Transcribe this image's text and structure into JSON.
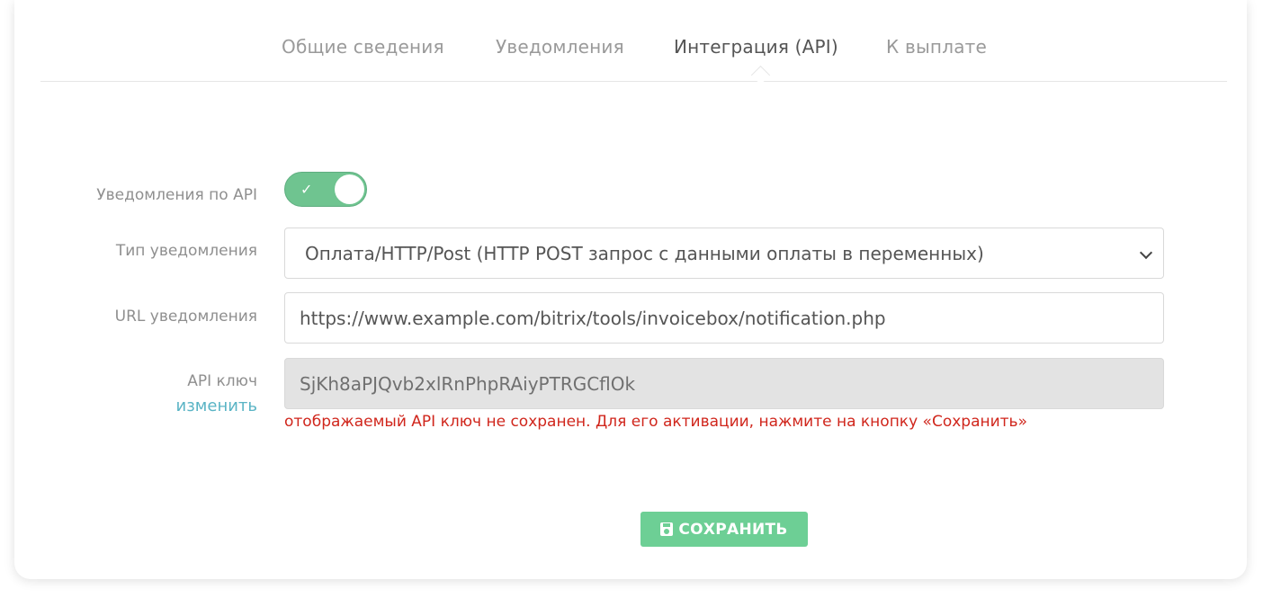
{
  "tabs": [
    {
      "label": "Общие сведения",
      "active": false
    },
    {
      "label": "Уведомления",
      "active": false
    },
    {
      "label": "Интеграция (API)",
      "active": true
    },
    {
      "label": "К выплате",
      "active": false
    }
  ],
  "form": {
    "api_notifications": {
      "label": "Уведомления по API",
      "enabled": true,
      "check_icon": "check-icon"
    },
    "notification_type": {
      "label": "Тип уведомления",
      "value": "Оплата/HTTP/Post (HTTP POST запрос с данными оплаты в переменных)"
    },
    "notification_url": {
      "label": "URL уведомления",
      "value": "https://www.example.com/bitrix/tools/invoicebox/notification.php"
    },
    "api_key": {
      "label": "API ключ",
      "change_link": "изменить",
      "value": "SjKh8aPJQvb2xlRnPhpRAiyPTRGCflOk",
      "warning": "отображаемый API ключ не сохранен. Для его активации, нажмите на кнопку «Сохранить»"
    }
  },
  "save_button": {
    "label": "СОХРАНИТЬ",
    "icon": "floppy-disk-icon"
  },
  "colors": {
    "accent_green": "#6fc490",
    "button_green": "#6dcf95",
    "link_teal": "#5ab4c5",
    "warning_red": "#d0261c"
  }
}
